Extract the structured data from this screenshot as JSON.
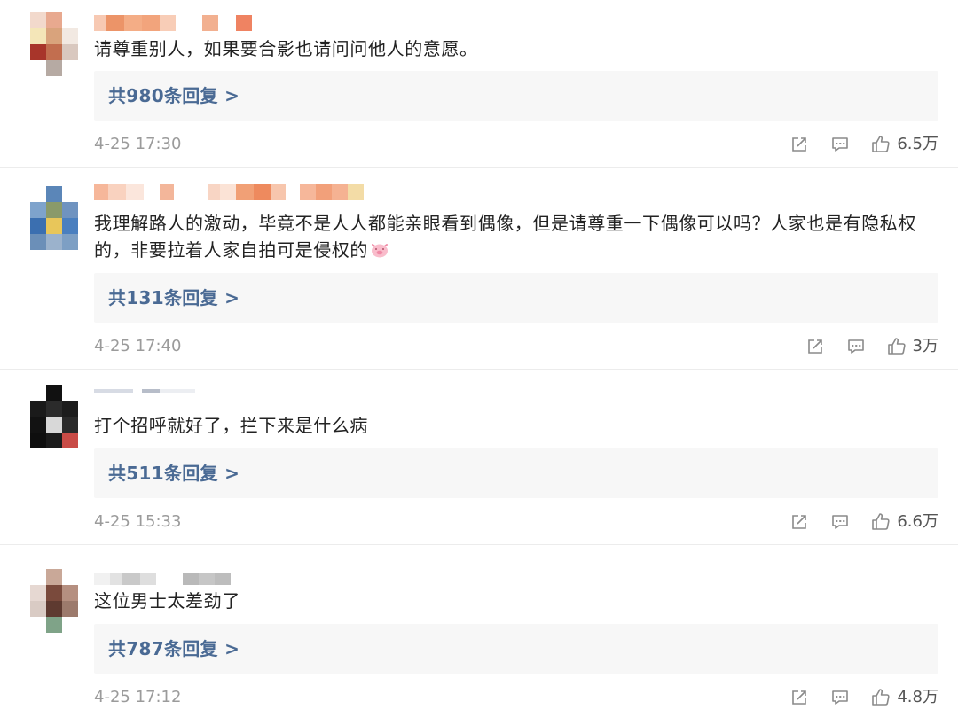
{
  "comments": [
    {
      "text": "请尊重别人，如果要合影也请问问他人的意愿。",
      "reply_label": "共980条回复 >",
      "time": "4-25 17:30",
      "likes": "6.5万"
    },
    {
      "text": "我理解路人的激动，毕竟不是人人都能亲眼看到偶像，但是请尊重一下偶像可以吗？人家也是有隐私权的，非要拉着人家自拍可是侵权的",
      "reply_label": "共131条回复 >",
      "time": "4-25 17:40",
      "likes": "3万"
    },
    {
      "text": "打个招呼就好了，拦下来是什么病",
      "reply_label": "共511条回复 >",
      "time": "4-25 15:33",
      "likes": "6.6万"
    },
    {
      "text": "这位男士太差劲了",
      "reply_label": "共787条回复 >",
      "time": "4-25 17:12",
      "likes": "4.8万"
    }
  ],
  "icons": {
    "share": "share-icon",
    "comment": "comment-icon",
    "like": "thumbs-up-icon",
    "emoji": "pig-face-emoji-icon"
  },
  "colors": {
    "reply_link": "#4a6a94",
    "reply_bg": "#f7f7f7",
    "meta": "#9b9b9b",
    "divider": "#ececec"
  }
}
